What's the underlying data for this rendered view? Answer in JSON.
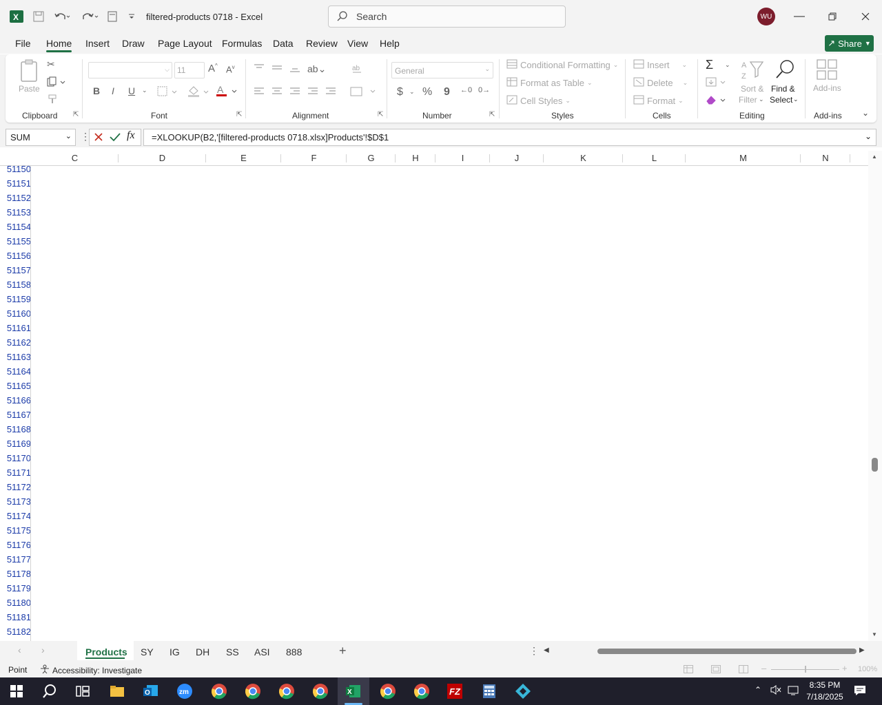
{
  "app": {
    "title": "filtered-products 0718  -  Excel",
    "search_placeholder": "Search",
    "user_initials": "WU"
  },
  "menu": {
    "tabs": [
      "File",
      "Home",
      "Insert",
      "Draw",
      "Page Layout",
      "Formulas",
      "Data",
      "Review",
      "View",
      "Help"
    ],
    "active_tab": "Home",
    "share_label": "Share"
  },
  "ribbon": {
    "clipboard": {
      "label": "Clipboard",
      "paste": "Paste"
    },
    "font": {
      "label": "Font",
      "size": "11",
      "bold": "B",
      "italic": "I",
      "underline": "U"
    },
    "alignment": {
      "label": "Alignment"
    },
    "number": {
      "label": "Number",
      "format": "General",
      "currency": "$",
      "percent": "%",
      "comma": "9"
    },
    "styles": {
      "label": "Styles",
      "conditional": "Conditional Formatting",
      "format_table": "Format as Table",
      "cell_styles": "Cell Styles"
    },
    "cells": {
      "label": "Cells",
      "insert": "Insert",
      "delete": "Delete",
      "format": "Format"
    },
    "editing": {
      "label": "Editing",
      "sort_line1": "Sort &",
      "sort_line2": "Filter",
      "find_line1": "Find &",
      "find_line2": "Select"
    },
    "addins": {
      "label": "Add-ins",
      "addins": "Add-ins"
    }
  },
  "formula_bar": {
    "name_box": "SUM",
    "formula": "=XLOOKUP(B2,'[filtered-products 0718.xlsx]Products'!$D$1"
  },
  "columns": [
    "C",
    "D",
    "E",
    "F",
    "G",
    "H",
    "I",
    "J",
    "K",
    "L",
    "M",
    "N"
  ],
  "rows": [
    "51150",
    "51151",
    "51152",
    "51153",
    "51154",
    "51155",
    "51156",
    "51157",
    "51158",
    "51159",
    "51160",
    "51161",
    "51162",
    "51163",
    "51164",
    "51165",
    "51166",
    "51167",
    "51168",
    "51169",
    "51170",
    "51171",
    "51172",
    "51173",
    "51174",
    "51175",
    "51176",
    "51177",
    "51178",
    "51179",
    "51180",
    "51181",
    "51182"
  ],
  "sheets": [
    "Products",
    "SY",
    "IG",
    "DH",
    "SS",
    "ASI",
    "888"
  ],
  "active_sheet": "Products",
  "status": {
    "mode": "Point",
    "accessibility": "Accessibility: Investigate",
    "zoom": "100%"
  },
  "taskbar": {
    "time": "8:35 PM",
    "date": "7/18/2025"
  },
  "colors": {
    "accent": "#1f7145",
    "avatar": "#7c1d2c",
    "row_numbers": "#1a3aa8"
  }
}
